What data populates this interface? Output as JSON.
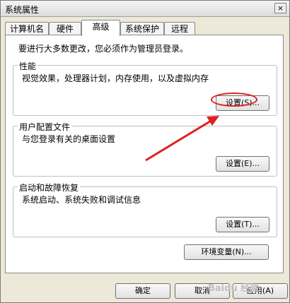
{
  "window": {
    "title": "系统属性",
    "close_label": "×"
  },
  "tabs": [
    {
      "label": "计算机名"
    },
    {
      "label": "硬件"
    },
    {
      "label": "高级"
    },
    {
      "label": "系统保护"
    },
    {
      "label": "远程"
    }
  ],
  "active_tab": "高级",
  "intro_text": "要进行大多数更改，您必须作为管理员登录。",
  "performance": {
    "title": "性能",
    "description": "视觉效果，处理器计划，内存使用，以及虚拟内存",
    "button": "设置(S)..."
  },
  "user_profiles": {
    "title": "用户配置文件",
    "description": "与您登录有关的桌面设置",
    "button": "设置(E)..."
  },
  "startup_recovery": {
    "title": "启动和故障恢复",
    "description": "系统启动、系统失败和调试信息",
    "button": "设置(T)..."
  },
  "env_vars_button": "环境变量(N)...",
  "footer": {
    "ok": "确定",
    "cancel": "取消",
    "apply": "应用(A)"
  },
  "annotation_color": "#e02020",
  "watermark_text": "Baidu 经验"
}
